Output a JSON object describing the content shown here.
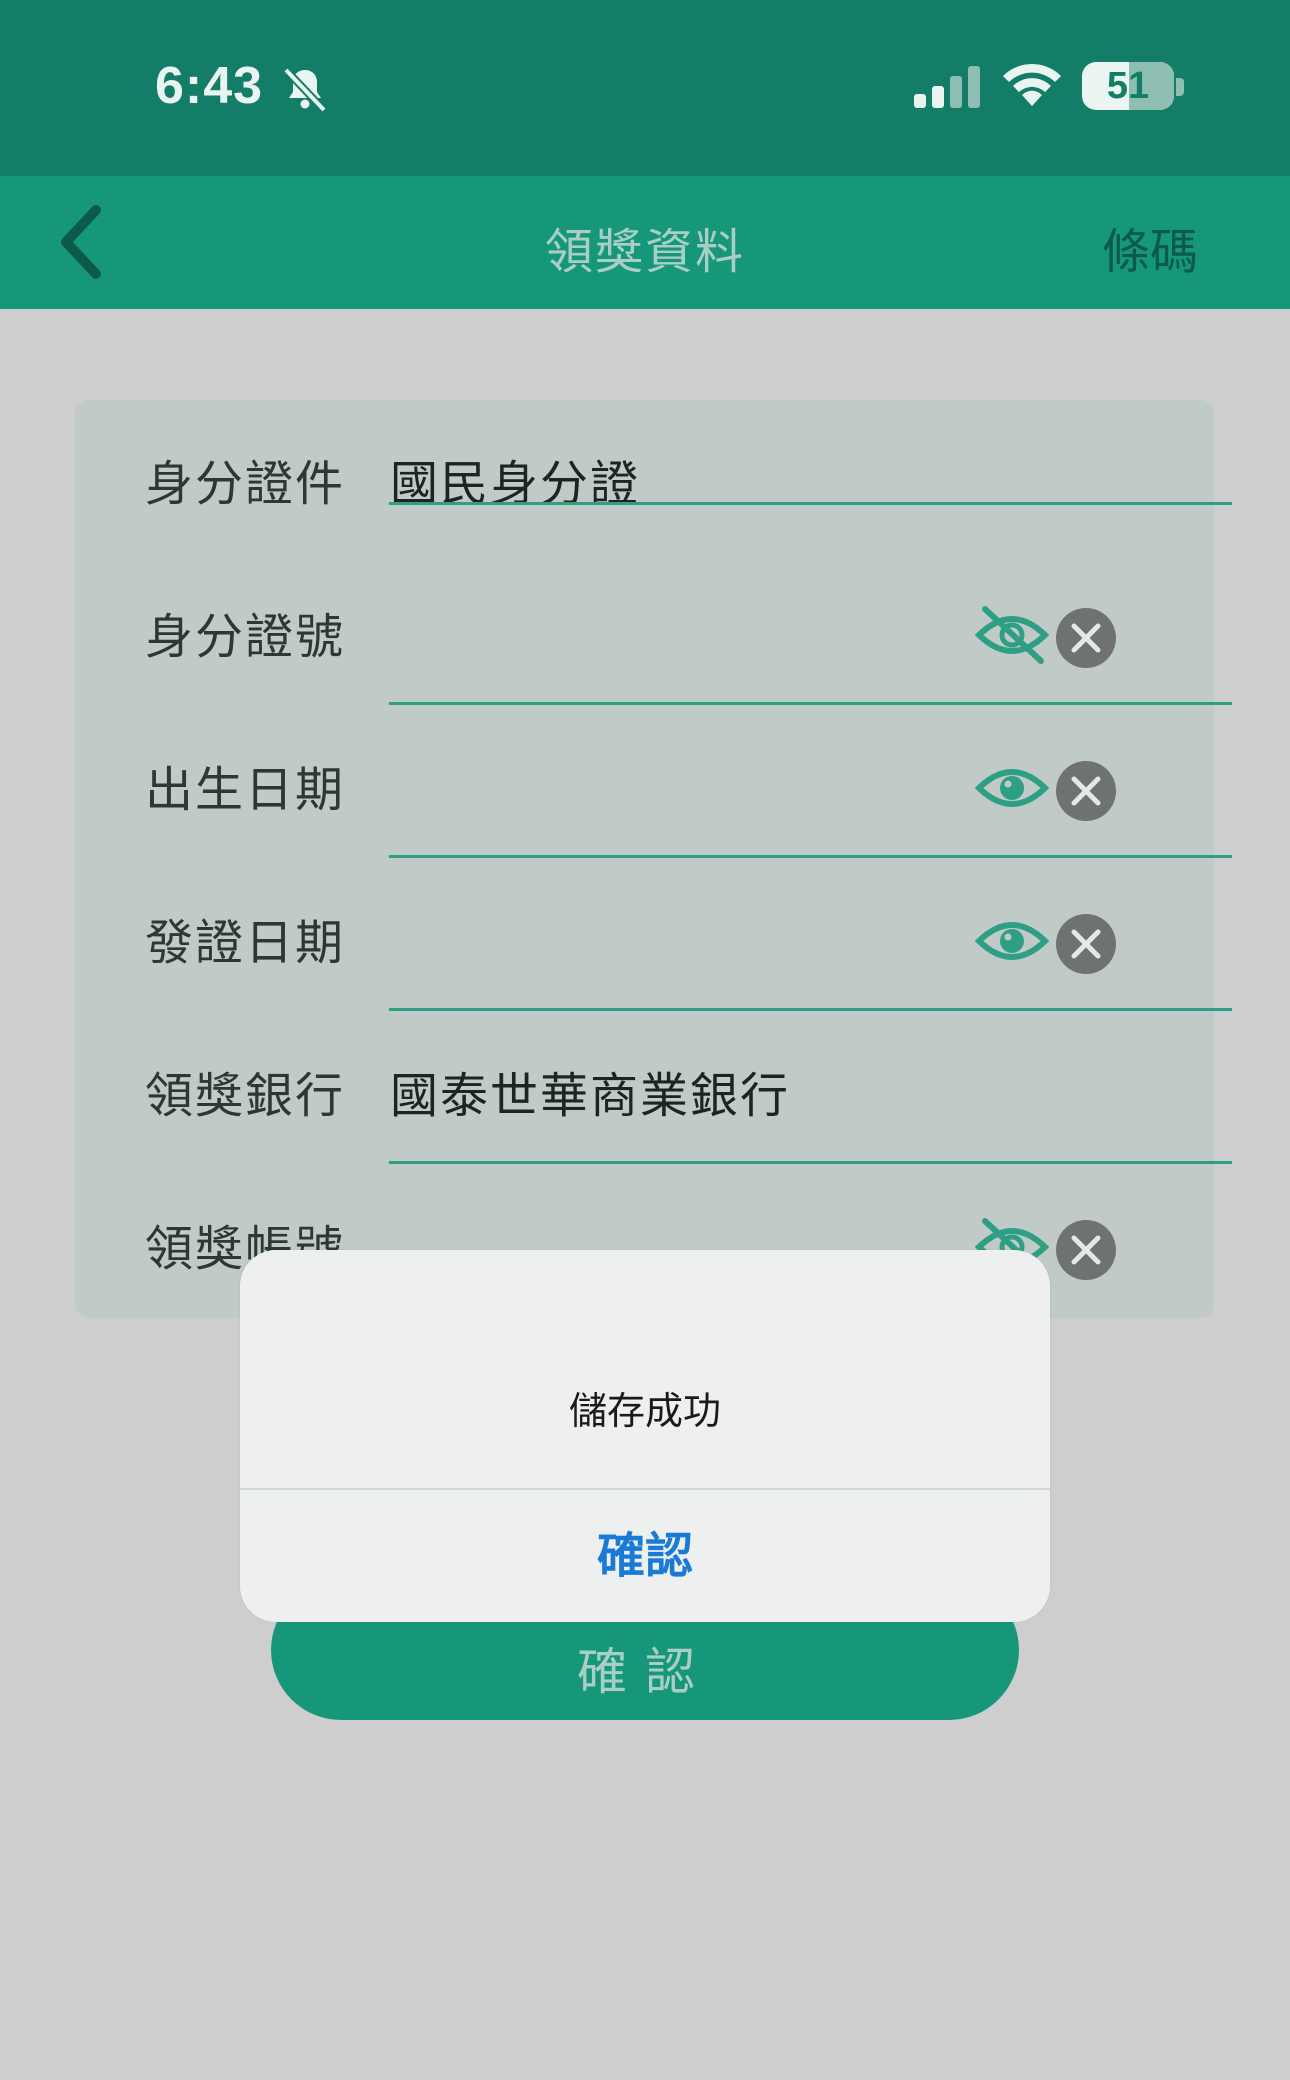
{
  "status_bar": {
    "time": "6:43",
    "battery": "51",
    "battery_level": 0.51
  },
  "nav": {
    "title": "領獎資料",
    "right_action": "條碼"
  },
  "form": {
    "rows": [
      {
        "label": "身分證件",
        "value": "國民身分證",
        "eye": "none"
      },
      {
        "label": "身分證號",
        "value": "",
        "eye": "eye-slash-icon"
      },
      {
        "label": "出生日期",
        "value": "",
        "eye": "eye-icon"
      },
      {
        "label": "發證日期",
        "value": "",
        "eye": "eye-icon"
      },
      {
        "label": "領獎銀行",
        "value": "國泰世華商業銀行",
        "eye": "none"
      },
      {
        "label": "領獎帳號",
        "value": "",
        "eye": "eye-slash-icon"
      }
    ]
  },
  "confirm_button": {
    "label": "確認"
  },
  "alert": {
    "message": "儲存成功",
    "button_label": "確認"
  },
  "colors": {
    "status_bar": "#147d67",
    "nav_bar": "#169779",
    "accent": "#2e9f85",
    "alert_button": "#1a7bd6",
    "card": "#c0cbc7",
    "background": "#cecece"
  }
}
